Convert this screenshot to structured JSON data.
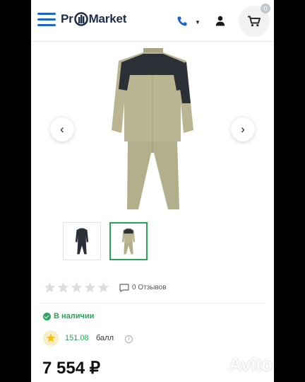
{
  "header": {
    "logo_prefix": "Pr",
    "logo_suffix": "Market",
    "cart_count": "0"
  },
  "gallery": {
    "prev_label": "‹",
    "next_label": "›",
    "thumbnails": [
      "dark suit",
      "beige suit"
    ]
  },
  "rating": {
    "stars": 0,
    "reviews_label": "0 Отзывов"
  },
  "stock": {
    "label": "В наличии"
  },
  "bonus": {
    "value": "151.08",
    "unit": "балл"
  },
  "price": {
    "value": "7 554 ₽"
  },
  "watermark": "Avito",
  "colors": {
    "accent_blue": "#1f66c8",
    "accent_green": "#2aa55a",
    "suit_beige": "#b9b592",
    "suit_dark": "#2a3036"
  }
}
